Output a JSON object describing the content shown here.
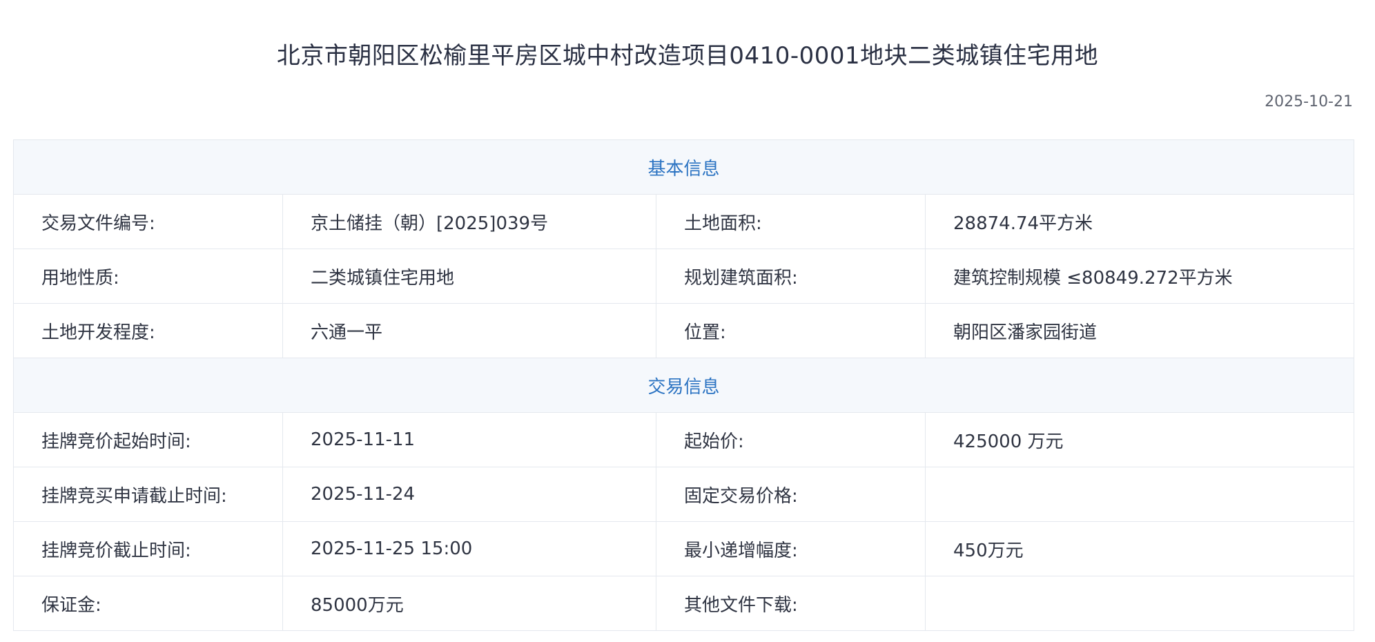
{
  "title": "北京市朝阳区松榆里平房区城中村改造项目0410-0001地块二类城镇住宅用地",
  "date": "2025-10-21",
  "sections": [
    {
      "heading": "基本信息",
      "rows": [
        [
          {
            "label": "交易文件编号:",
            "value": "京土储挂（朝）[2025]039号"
          },
          {
            "label": "土地面积:",
            "value": "28874.74平方米"
          }
        ],
        [
          {
            "label": "用地性质:",
            "value": "二类城镇住宅用地"
          },
          {
            "label": "规划建筑面积:",
            "value": "建筑控制规模 ≤80849.272平方米"
          }
        ],
        [
          {
            "label": "土地开发程度:",
            "value": "六通一平"
          },
          {
            "label": "位置:",
            "value": "朝阳区潘家园街道"
          }
        ]
      ]
    },
    {
      "heading": "交易信息",
      "rows": [
        [
          {
            "label": "挂牌竞价起始时间:",
            "value": "2025-11-11"
          },
          {
            "label": "起始价:",
            "value": "425000 万元"
          }
        ],
        [
          {
            "label": "挂牌竞买申请截止时间:",
            "value": "2025-11-24"
          },
          {
            "label": "固定交易价格:",
            "value": ""
          }
        ],
        [
          {
            "label": "挂牌竞价截止时间:",
            "value": "2025-11-25 15:00"
          },
          {
            "label": "最小递增幅度:",
            "value": "450万元"
          }
        ],
        [
          {
            "label": "保证金:",
            "value": "85000万元"
          },
          {
            "label": "其他文件下载:",
            "value": ""
          }
        ]
      ]
    }
  ]
}
